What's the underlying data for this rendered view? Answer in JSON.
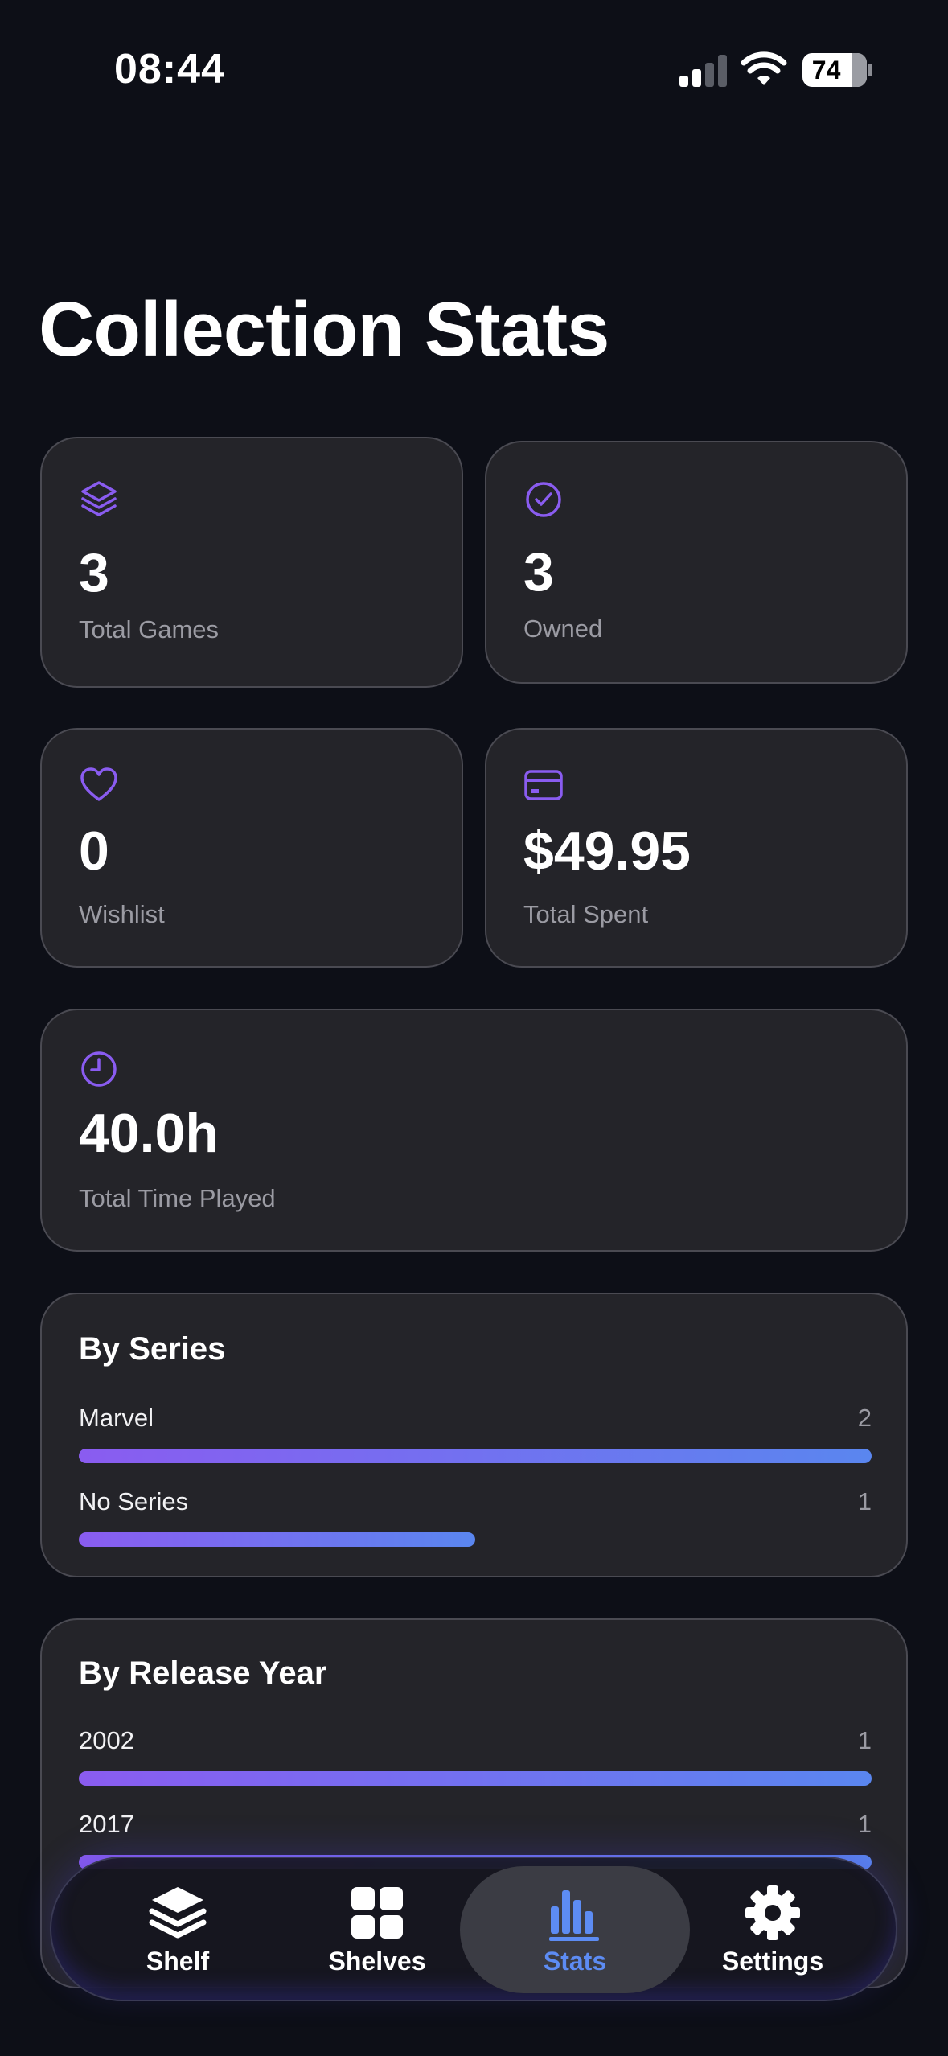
{
  "status_bar": {
    "time": "08:44",
    "battery": "74",
    "battery_level": 0.74,
    "signal_bars": 2
  },
  "page": {
    "title": "Collection Stats"
  },
  "colors": {
    "accent_purple": "#8a5cf0",
    "accent_blue": "#5a86ef",
    "active_tab": "#5d8cf3",
    "card_bg": "#242429"
  },
  "stats": {
    "total_games": {
      "icon": "layers-icon",
      "value": "3",
      "label": "Total Games"
    },
    "owned": {
      "icon": "check-circle-icon",
      "value": "3",
      "label": "Owned"
    },
    "wishlist": {
      "icon": "heart-icon",
      "value": "0",
      "label": "Wishlist"
    },
    "total_spent": {
      "icon": "credit-card-icon",
      "value": "$49.95",
      "label": "Total Spent"
    },
    "time_played": {
      "icon": "clock-icon",
      "value": "40.0h",
      "label": "Total Time Played"
    }
  },
  "by_series": {
    "title": "By Series",
    "items": [
      {
        "label": "Marvel",
        "count": "2",
        "fraction": 1.0
      },
      {
        "label": "No Series",
        "count": "1",
        "fraction": 0.5
      }
    ]
  },
  "by_release_year": {
    "title": "By Release Year",
    "items": [
      {
        "label": "2002",
        "count": "1",
        "fraction": 1.0
      },
      {
        "label": "2017",
        "count": "1",
        "fraction": 1.0
      }
    ]
  },
  "tabbar": {
    "tabs": [
      {
        "label": "Shelf",
        "icon": "stack-icon"
      },
      {
        "label": "Shelves",
        "icon": "grid-icon"
      },
      {
        "label": "Stats",
        "icon": "bar-chart-icon",
        "active": true
      },
      {
        "label": "Settings",
        "icon": "gear-icon"
      }
    ]
  }
}
